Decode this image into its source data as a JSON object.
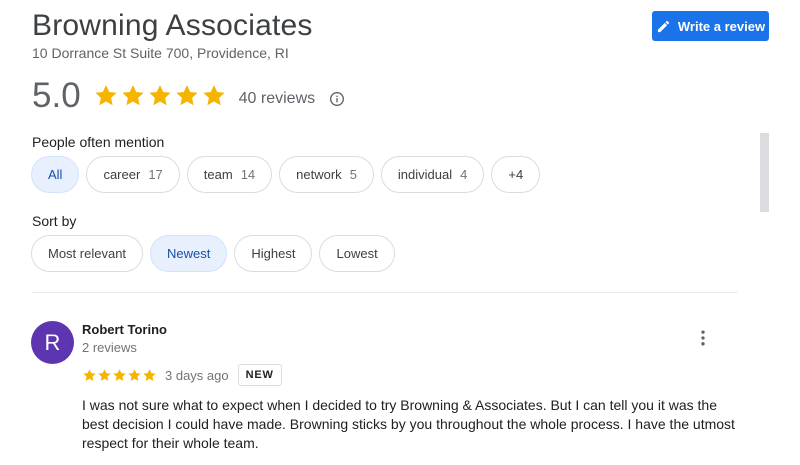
{
  "business": {
    "name": "Browning Associates",
    "address": "10 Dorrance St Suite 700, Providence, RI"
  },
  "write_review": {
    "label": "Write a review",
    "icon": "pencil-icon"
  },
  "rating": {
    "value": "5.0",
    "stars": 5,
    "reviews_text": "40 reviews",
    "star_color": "#f4b400"
  },
  "mentions": {
    "label": "People often mention",
    "chips": [
      {
        "label": "All",
        "count": "",
        "active": true
      },
      {
        "label": "career",
        "count": "17",
        "active": false
      },
      {
        "label": "team",
        "count": "14",
        "active": false
      },
      {
        "label": "network",
        "count": "5",
        "active": false
      },
      {
        "label": "individual",
        "count": "4",
        "active": false
      },
      {
        "label": "+4",
        "count": "",
        "active": false
      }
    ]
  },
  "sort": {
    "label": "Sort by",
    "options": [
      {
        "label": "Most relevant",
        "active": false
      },
      {
        "label": "Newest",
        "active": true
      },
      {
        "label": "Highest",
        "active": false
      },
      {
        "label": "Lowest",
        "active": false
      }
    ]
  },
  "review": {
    "avatar_letter": "R",
    "avatar_color": "#5e35b1",
    "name": "Robert Torino",
    "meta": "2 reviews",
    "stars": 5,
    "date": "3 days ago",
    "badge": "NEW",
    "text": "I was not sure what to expect when I decided to try Browning & Associates. But I can tell you it was the best decision I could have made. Browning sticks by you throughout the whole process. I have the utmost respect for their whole team."
  },
  "colors": {
    "accent": "#1a73e8",
    "chip_active_bg": "#e8f0fe",
    "chip_active_text": "#174ea6"
  }
}
